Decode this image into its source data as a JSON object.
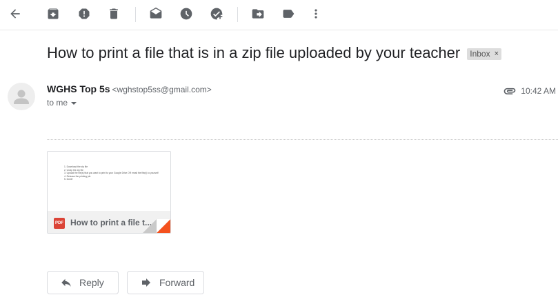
{
  "toolbar": {
    "buttons": [
      {
        "name": "back",
        "icon": "arrow-left-icon"
      },
      {
        "name": "archive",
        "icon": "archive-icon"
      },
      {
        "name": "report-spam",
        "icon": "report-spam-icon"
      },
      {
        "name": "delete",
        "icon": "trash-icon"
      },
      {
        "name": "mark-unread",
        "icon": "mark-unread-icon"
      },
      {
        "name": "snooze",
        "icon": "clock-icon"
      },
      {
        "name": "add-to-tasks",
        "icon": "add-task-icon"
      },
      {
        "name": "move-to",
        "icon": "move-to-icon"
      },
      {
        "name": "labels",
        "icon": "label-icon"
      },
      {
        "name": "more",
        "icon": "more-vert-icon"
      }
    ]
  },
  "message": {
    "subject": "How to print a file that is in a zip file uploaded by your teacher",
    "label": "Inbox",
    "label_remove": "×",
    "sender_name": "WGHS Top 5s",
    "sender_email": "<wghstop5ss@gmail.com>",
    "recipient": "to me",
    "time": "10:42 AM"
  },
  "attachment": {
    "type_badge": "PDF",
    "name": "How to print a file t...",
    "preview_lines": [
      "1.   Download the zip file",
      "2.   Unzip the zip file",
      "3.   Upload the file(s) that you want to print to your Google Drive OR email the file(s) to yourself",
      "4.   Release the printing job",
      "5.   Done!"
    ]
  },
  "actions": {
    "reply_label": "Reply",
    "forward_label": "Forward"
  },
  "colors": {
    "icon_gray": "#5f6368",
    "pdf_red": "#db4437",
    "chip_bg": "#dddddd",
    "corner_orange": "#f4511e"
  }
}
